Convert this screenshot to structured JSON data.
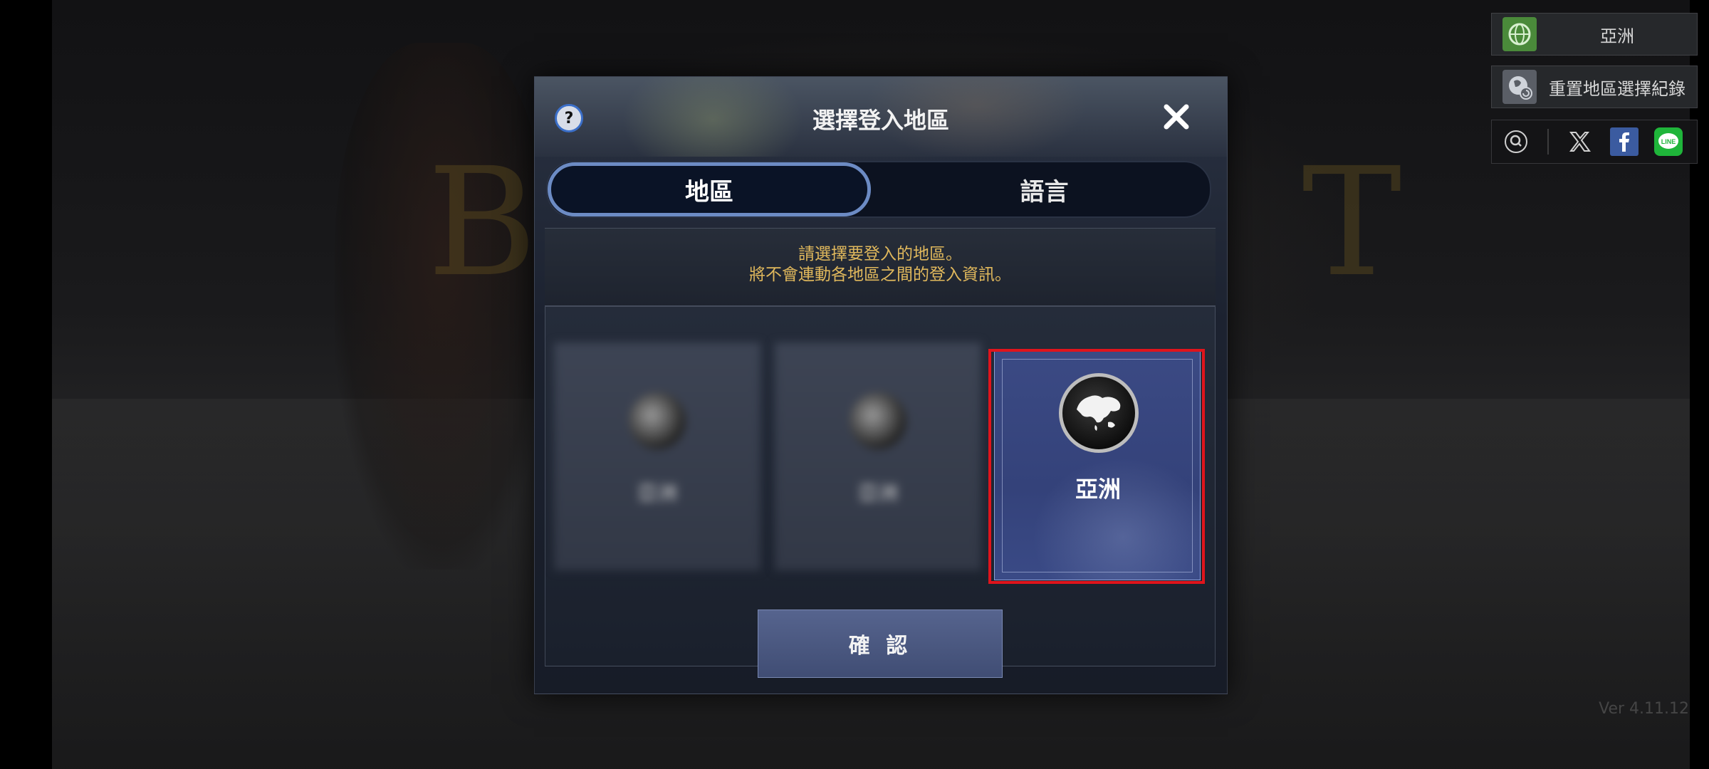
{
  "top_right": {
    "region_label": "亞洲",
    "reset_label": "重置地區選擇紀錄"
  },
  "dialog": {
    "title": "選擇登入地區",
    "tabs": [
      {
        "label": "地區",
        "active": true
      },
      {
        "label": "語言",
        "active": false
      }
    ],
    "info_line1": "請選擇要登入的地區。",
    "info_line2": "將不會連動各地區之間的登入資訊。",
    "regions": [
      {
        "label": "亞洲",
        "blurred": true
      },
      {
        "label": "亞洲",
        "blurred": true
      },
      {
        "label": "亞洲",
        "blurred": false,
        "selected": true
      }
    ],
    "confirm_label": "確 認"
  },
  "version": "Ver 4.11.12",
  "colors": {
    "accent_gold": "#e0b85c",
    "selection_red": "#e0141c",
    "tab_border": "#6c8bc4"
  }
}
